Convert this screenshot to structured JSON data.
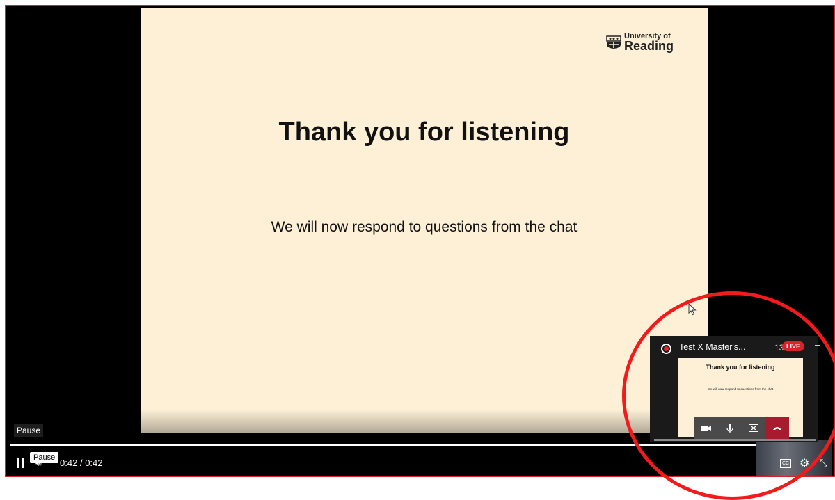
{
  "slide": {
    "logo_line1": "University of",
    "logo_line2": "Reading",
    "title": "Thank you for listening",
    "subtitle": "We will now respond to questions from the chat"
  },
  "player": {
    "tooltip_pause": "Pause",
    "button_tooltip": "Pause",
    "time_current": "0:42",
    "time_separator": "/",
    "time_total": "0:42",
    "progress": 1.0
  },
  "pip": {
    "meeting_title": "Test X Master's...",
    "clock": "13:27",
    "live_label": "LIVE",
    "slide_title": "Thank you for listening",
    "slide_subtitle": "We will now respond to questions from the chat"
  },
  "colors": {
    "frame_border": "#d6242b",
    "slide_bg": "#fdf0d6",
    "annotation_circle": "#f21b1b",
    "live_badge": "#d6242b",
    "end_call": "#a41c2e"
  },
  "icons": [
    "crest-icon",
    "cursor-icon",
    "pause-icon",
    "volume-icon",
    "captions-icon",
    "gear-icon",
    "exit-fullscreen-icon",
    "record-icon",
    "camera-icon",
    "mic-icon",
    "stop-share-icon",
    "end-call-icon",
    "minimize-icon"
  ]
}
